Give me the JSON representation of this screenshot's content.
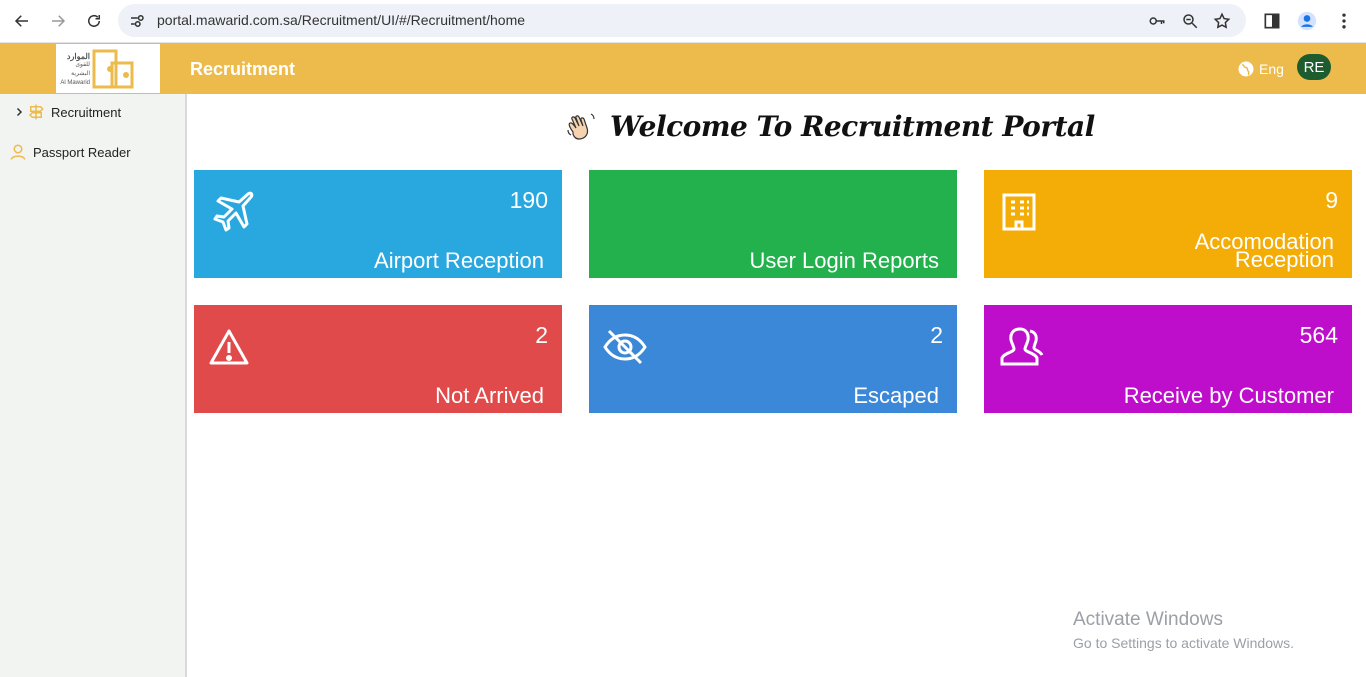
{
  "browser": {
    "url": "portal.mawarid.com.sa/Recruitment/UI/#/Recruitment/home"
  },
  "header": {
    "logo_arabic": "الموارد",
    "logo_arabic_sub": "للقوى البشرية",
    "logo_latin": "Al Mawarid",
    "title": "Recruitment",
    "language": "Eng",
    "user_initials": "RE",
    "accent_color": "#ecbb4c"
  },
  "sidebar": {
    "items": [
      {
        "label": "Recruitment",
        "icon": "signpost-icon",
        "expandable": true
      },
      {
        "label": "Passport Reader",
        "icon": "user-outline-icon",
        "expandable": false
      }
    ]
  },
  "main": {
    "welcome_title": "Welcome To Recruitment Portal",
    "cards": [
      {
        "label": "Airport Reception",
        "count": "190",
        "color": "#29a8e0",
        "icon": "airplane-icon"
      },
      {
        "label": "User Login Reports",
        "count": "",
        "color": "#22b14c",
        "icon": ""
      },
      {
        "label_line1": "Accomodation",
        "label_line2": "Reception",
        "count": "9",
        "color": "#f4ac06",
        "icon": "building-icon"
      },
      {
        "label": "Not Arrived",
        "count": "2",
        "color": "#e04a4a",
        "icon": "warning-icon"
      },
      {
        "label": "Escaped",
        "count": "2",
        "color": "#3b88d8",
        "icon": "eye-slash-icon"
      },
      {
        "label": "Receive by Customer",
        "count": "564",
        "color": "#bf0ecb",
        "icon": "users-icon"
      }
    ]
  },
  "watermark": {
    "line1": "Activate Windows",
    "line2": "Go to Settings to activate Windows."
  }
}
